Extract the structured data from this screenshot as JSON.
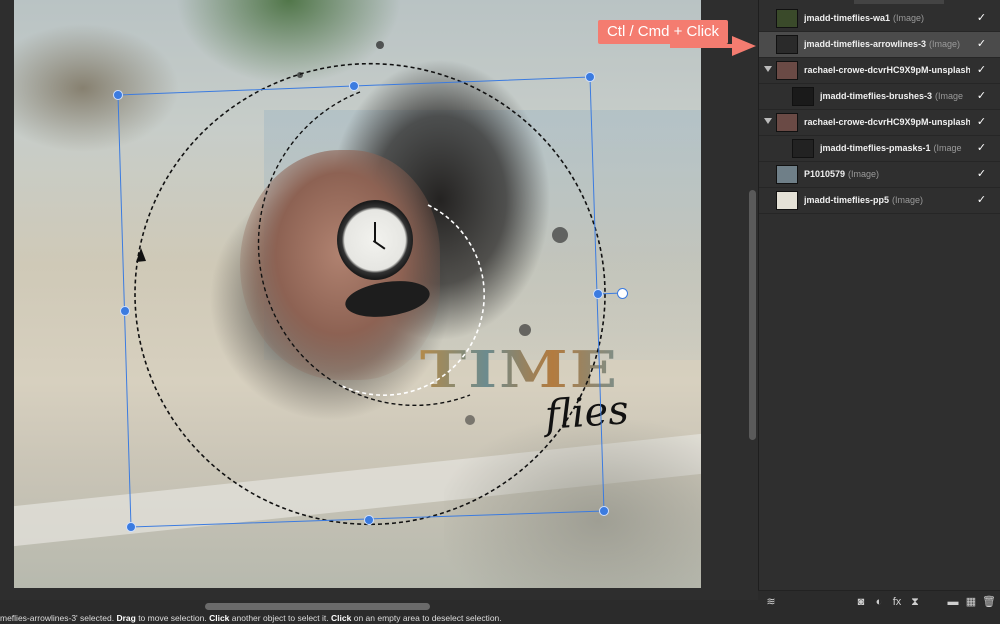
{
  "callout": {
    "text": "Ctl / Cmd + Click"
  },
  "layers": [
    {
      "name": "jmadd-timeflies-wa1",
      "kind": "(Image)",
      "indent": false,
      "expander": false,
      "thumb": "#3a4a2a",
      "selected": false,
      "checked": "✓"
    },
    {
      "name": "jmadd-timeflies-arrowlines-3",
      "kind": "(Image)",
      "indent": false,
      "expander": false,
      "thumb": "#2a2a2a",
      "selected": true,
      "checked": "✓"
    },
    {
      "name": "rachael-crowe-dcvrHC9X9pM-unsplash",
      "kind": "",
      "indent": false,
      "expander": true,
      "thumb": "#6a4a45",
      "selected": false,
      "checked": "✓"
    },
    {
      "name": "jmadd-timeflies-brushes-3",
      "kind": "(Image",
      "indent": true,
      "expander": false,
      "thumb": "#1a1a1a",
      "selected": false,
      "checked": "✓"
    },
    {
      "name": "rachael-crowe-dcvrHC9X9pM-unsplash",
      "kind": "",
      "indent": false,
      "expander": true,
      "thumb": "#6a4a45",
      "selected": false,
      "checked": "✓"
    },
    {
      "name": "jmadd-timeflies-pmasks-1",
      "kind": "(Image",
      "indent": true,
      "expander": false,
      "thumb": "#222",
      "selected": false,
      "checked": "✓"
    },
    {
      "name": "P1010579",
      "kind": "(Image)",
      "indent": false,
      "expander": false,
      "thumb": "#6f7f88",
      "selected": false,
      "checked": "✓"
    },
    {
      "name": "jmadd-timeflies-pp5",
      "kind": "(Image)",
      "indent": false,
      "expander": false,
      "thumb": "#e4e1d6",
      "selected": false,
      "checked": "✓"
    }
  ],
  "canvas": {
    "title_word": "TIME",
    "script_word": "flies"
  },
  "status": {
    "selected_text": "meflies-arrowlines-3' selected.",
    "drag_label": "Drag",
    "drag_text": "to move selection.",
    "click_label": "Click",
    "click_text": "another object to select it.",
    "click2_label": "Click",
    "click2_text": "on an empty area to deselect selection."
  },
  "toolbar": {
    "icons": [
      "layers-icon",
      "mask-icon",
      "adjustment-icon",
      "fx-icon",
      "live-filter-icon",
      "group-folder-icon",
      "add-pixel-layer-icon",
      "trash-icon"
    ],
    "glyphs": [
      "≋",
      "◙",
      "◐",
      "fx",
      "⧗",
      "▬",
      "▦",
      "🗑"
    ]
  },
  "colors": {
    "selection": "#3b7be0",
    "callout": "#f47c70",
    "panel": "#2f2f2f",
    "selected_row": "#4b4b4b"
  }
}
